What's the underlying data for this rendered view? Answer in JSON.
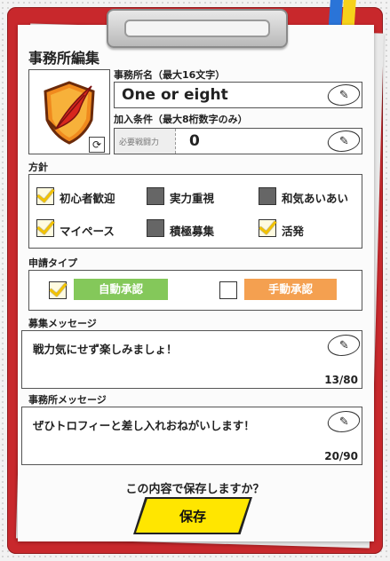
{
  "header": {
    "title": "事務所編集"
  },
  "name_field": {
    "label": "事務所名（最大16文字）",
    "value": "One or eight"
  },
  "join_field": {
    "label": "加入条件（最大8桁数字のみ）",
    "sub_label": "必要戦闘力",
    "value": "0"
  },
  "policy": {
    "label": "方針",
    "options": [
      {
        "label": "初心者歓迎",
        "checked": true
      },
      {
        "label": "実力重視",
        "checked": false
      },
      {
        "label": "和気あいあい",
        "checked": false
      },
      {
        "label": "マイペース",
        "checked": true
      },
      {
        "label": "積極募集",
        "checked": false
      },
      {
        "label": "活発",
        "checked": true
      }
    ]
  },
  "apply_type": {
    "label": "申請タイプ",
    "auto": {
      "label": "自動承認",
      "checked": true
    },
    "manual": {
      "label": "手動承認",
      "checked": false
    }
  },
  "recruit_message": {
    "label": "募集メッセージ",
    "text": "戦力気にせず楽しみましょ！",
    "count": "13/80"
  },
  "office_message": {
    "label": "事務所メッセージ",
    "text": "ぜひトロフィーと差し入れおねがいします！",
    "count": "20/90"
  },
  "footer": {
    "question": "この内容で保存しますか？",
    "save_label": "保存"
  },
  "icons": {
    "edit": "pencil-icon",
    "refresh": "refresh-icon",
    "emblem": "feather-shield-icon"
  },
  "colors": {
    "board": "#c8282c",
    "save": "#ffe600",
    "auto": "#84c85a",
    "manual": "#f4a050",
    "check": "#f2c200"
  }
}
